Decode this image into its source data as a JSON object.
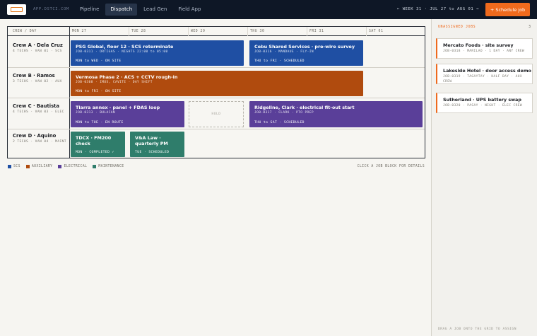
{
  "app": {
    "domain": "APP.DSTCI.COM"
  },
  "nav": {
    "items": [
      "Pipeline",
      "Dispatch",
      "Lead Gen",
      "Field App"
    ],
    "active": "Dispatch"
  },
  "header": {
    "week_label": "← WEEK 31 · JUL 27 to AUG 01 →",
    "schedule_button": "+ Schedule job"
  },
  "grid": {
    "crew_header": "CREW / DAY",
    "days": [
      "MON 27",
      "TUE 28",
      "WED 29",
      "THU 30",
      "FRI 31",
      "SAT 01"
    ],
    "crews": [
      {
        "name": "Crew A · Dela Cruz",
        "meta": "4 TECHS · VAN 01 · SCS"
      },
      {
        "name": "Crew B · Ramos",
        "meta": "3 TECHS · VAN 02 · AUX"
      },
      {
        "name": "Crew C · Bautista",
        "meta": "4 TECHS · VAN 03 · ELEC"
      },
      {
        "name": "Crew D · Aquino",
        "meta": "2 TECHS · VAN 04 · MAINT"
      }
    ],
    "jobs": [
      {
        "title": "PSG Global, floor 12 · SCS reterminate",
        "meta": "JOB-0311 · ORTIGAS · NIGHTS 22:00 to 05:00",
        "bottom": "MON to WED · ON SITE"
      },
      {
        "title": "Cebu Shared Services · pre-wire survey",
        "meta": "JOB-0316 · MANDAUE · FLY-IN",
        "bottom": "THU to FRI · SCHEDULED"
      },
      {
        "title": "Vermosa Phase 2 · ACS + CCTV rough-in",
        "meta": "JOB-0308 · IMUS, CAVITE · DAY SHIFT",
        "bottom": "MON to FRI · ON SITE"
      },
      {
        "title": "Tiarra annex · panel + FDAS loop",
        "meta": "JOB-0313 · BULACAN",
        "bottom": "MON to TUE · EN ROUTE"
      },
      {
        "title": "Ridgeline, Clark · electrical fit-out start",
        "meta": "JOB-0317 · CLARK · PTO PREP",
        "bottom": "THU to SAT · SCHEDULED"
      },
      {
        "title": "TDCX · FM200 check",
        "meta": "",
        "bottom": "MON · COMPLETED ✓"
      },
      {
        "title": "V&A Law · quarterly PM",
        "meta": "",
        "bottom": "TUE · SCHEDULED"
      }
    ],
    "hold_label": "HOLD"
  },
  "legend": {
    "items": [
      {
        "label": "SCS",
        "color": "#1f4fa3"
      },
      {
        "label": "AUXILIARY",
        "color": "#b04b0e"
      },
      {
        "label": "ELECTRICAL",
        "color": "#5a3f99"
      },
      {
        "label": "MAINTENANCE",
        "color": "#2f7d6b"
      }
    ],
    "hint": "CLICK A JOB BLOCK FOR DETAILS"
  },
  "panel": {
    "title": "UNASSIGNED JOBS",
    "count": "3",
    "cards": [
      {
        "title": "Mercato Foods · site survey",
        "meta": "JOB-0318 · MARILAO · 1 DAY · ANY CREW"
      },
      {
        "title": "Lakeside Hotel · door access demo",
        "meta": "JOB-0319 · TAGAYTAY · HALF DAY · AUX CREW"
      },
      {
        "title": "Sutherland · UPS battery swap",
        "meta": "JOB-0320 · PASAY · NIGHT · ELEC CREW"
      }
    ],
    "footer": "DRAG A JOB ONTO THE GRID TO ASSIGN"
  },
  "colors": {
    "accent": "#ef6a1d",
    "topbar": "#0e1726",
    "scs": "#1f4fa3",
    "aux": "#b04b0e",
    "elec": "#5a3f99",
    "maint": "#2f7d6b"
  }
}
